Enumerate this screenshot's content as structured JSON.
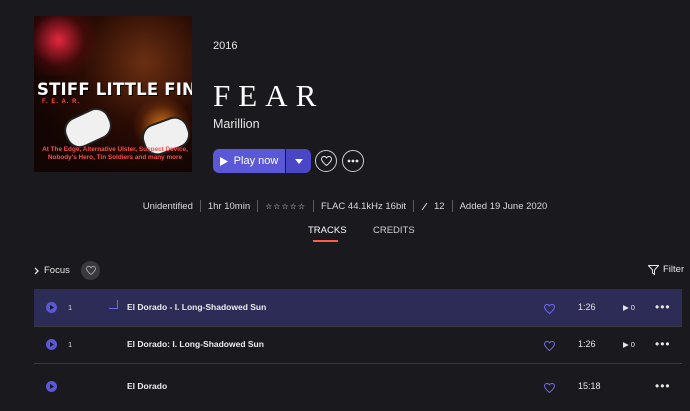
{
  "album": {
    "cover": {
      "band_text": "STIFF LITTLE FINGERS",
      "subtitle_text": "F. E. A. R.",
      "blurb": "At The Edge, Alternative Ulster, Suspect Device, Nobody's Hero, Tin Soldiers and many more"
    },
    "year": "2016",
    "title": "FEAR",
    "artist": "Marillion",
    "play_label": "Play now"
  },
  "meta": {
    "status": "Unidentified",
    "duration": "1hr 10min",
    "rating": "☆☆☆☆☆",
    "quality": "FLAC 44.1kHz 16bit",
    "track_count": "12",
    "added": "Added 19 June 2020"
  },
  "tabs": [
    "TRACKS",
    "CREDITS"
  ],
  "toolbar": {
    "focus_label": "Focus",
    "filter_label": "Filter"
  },
  "tracks": [
    {
      "number": "1",
      "name": "El Dorado - I. Long-Shadowed Sun",
      "duration": "1:26",
      "plays": "0"
    },
    {
      "number": "1",
      "name": "El Dorado: I. Long-Shadowed Sun",
      "duration": "1:26",
      "plays": "0"
    },
    {
      "number": "",
      "name": "El Dorado",
      "duration": "15:18",
      "plays": ""
    }
  ],
  "colors": {
    "accent": "#5b58d8",
    "tab_underline": "#ff5a46",
    "background": "#1a191d",
    "active_row": "#2d2c56"
  }
}
